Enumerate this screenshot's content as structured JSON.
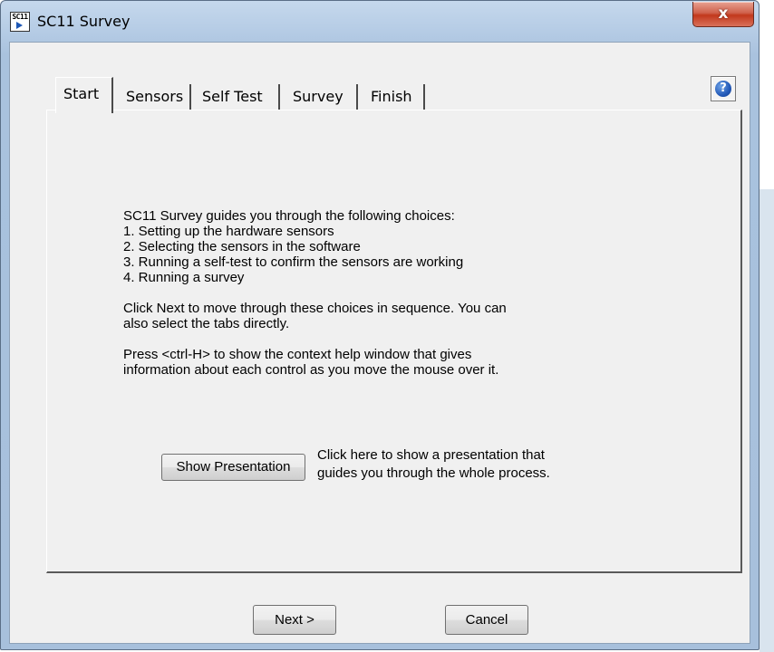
{
  "window": {
    "title": "SC11 Survey",
    "icon_text": "SC11",
    "close_glyph": "x"
  },
  "tabs": [
    {
      "label": "Start",
      "active": true
    },
    {
      "label": "Sensors",
      "active": false
    },
    {
      "label": "Self Test",
      "active": false
    },
    {
      "label": "Survey",
      "active": false
    },
    {
      "label": "Finish",
      "active": false
    }
  ],
  "help": {
    "glyph": "?"
  },
  "start_tab": {
    "intro": "SC11 Survey guides you through the following choices:",
    "steps": [
      "1. Setting up the hardware sensors",
      "2. Selecting the sensors in the software",
      "3. Running a self-test to confirm the sensors are working",
      "4. Running a survey"
    ],
    "next_hint_line1": "Click Next to move through these choices in sequence. You can",
    "next_hint_line2": "also select the tabs directly.",
    "help_hint_line1": "Press <ctrl-H> to show the context help window that gives",
    "help_hint_line2": "information about each control as you move the mouse over it.",
    "show_presentation_label": "Show Presentation",
    "presentation_hint_line1": "Click here to show a presentation that",
    "presentation_hint_line2": "guides you through the whole process."
  },
  "buttons": {
    "next": "Next >",
    "cancel": "Cancel"
  }
}
